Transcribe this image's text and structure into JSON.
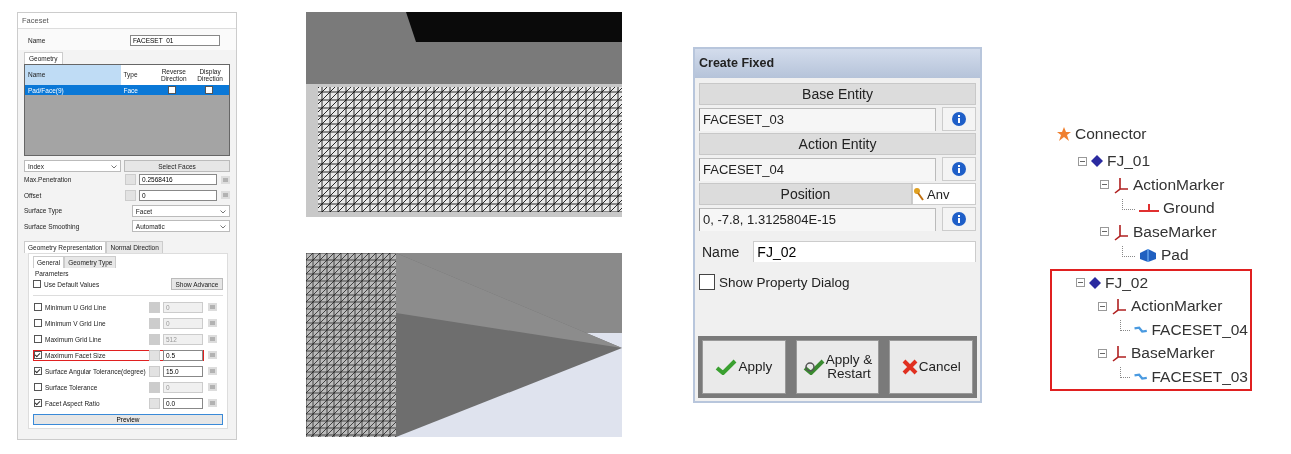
{
  "faceset_panel": {
    "title": "Faceset",
    "name_label": "Name",
    "name_value": "FACESET_01",
    "geometry_tab": "Geometry",
    "table": {
      "columns": [
        "Name",
        "Type",
        "Reverse Direction",
        "Display Direction"
      ],
      "rows": [
        {
          "name": "Pad/Face(9)",
          "type": "Face",
          "reverse_direction": false,
          "display_direction": false,
          "selected": true
        }
      ]
    },
    "index_dropdown": "Index",
    "select_faces_button": "Select Faces",
    "fields": [
      {
        "kind": "input",
        "label": "Max.Penetration",
        "value": "0.2568416"
      },
      {
        "kind": "input",
        "label": "Offset",
        "value": "0"
      },
      {
        "kind": "select",
        "label": "Surface Type",
        "value": "Facet"
      },
      {
        "kind": "select",
        "label": "Surface Smoothing",
        "value": "Automatic"
      }
    ],
    "tabs": [
      {
        "label": "Geometry Representation",
        "selected": true
      },
      {
        "label": "Normal Direction",
        "selected": false
      }
    ],
    "subtabs": [
      {
        "label": "General",
        "selected": true
      },
      {
        "label": "Geometry Type",
        "selected": false
      }
    ],
    "parameters_title": "Parameters",
    "use_default": {
      "label": "Use Default Values",
      "checked": false
    },
    "show_advance_button": "Show Advance",
    "params": [
      {
        "label": "Minimum U Grid Line",
        "checked": false,
        "value": "0",
        "highlighted": false
      },
      {
        "label": "Minimum V Grid Line",
        "checked": false,
        "value": "0",
        "highlighted": false
      },
      {
        "label": "Maximum Grid Line",
        "checked": false,
        "value": "512",
        "highlighted": false
      },
      {
        "label": "Maximum Facet Size",
        "checked": true,
        "value": "0.5",
        "highlighted": true
      },
      {
        "label": "Surface Angular Tolerance(degree)",
        "checked": true,
        "value": "15.0",
        "highlighted": false
      },
      {
        "label": "Surface Tolerance",
        "checked": false,
        "value": "0",
        "highlighted": false
      },
      {
        "label": "Facet Aspect Ratio",
        "checked": true,
        "value": "0.0",
        "highlighted": false
      }
    ],
    "preview_button": "Preview"
  },
  "create_fixed": {
    "title": "Create Fixed",
    "entities": [
      {
        "header": "Base Entity",
        "value": "FACESET_03"
      },
      {
        "header": "Action Entity",
        "value": "FACESET_04"
      },
      {
        "header": "Position",
        "value": "0, -7.8, 1.3125804E-15",
        "extra": "Anv"
      }
    ],
    "name_label": "Name",
    "name_value": "FJ_02",
    "show_property": {
      "label": "Show Property Dialog",
      "checked": false
    },
    "buttons": [
      {
        "kind": "apply",
        "label": "Apply"
      },
      {
        "kind": "restart",
        "label": "Apply &\nRestart"
      },
      {
        "kind": "cancel",
        "label": "Cancel"
      }
    ]
  },
  "tree": {
    "kind": "connector",
    "label": "Connector",
    "children": [
      {
        "kind": "joint",
        "label": "FJ_01",
        "highlighted": false,
        "children": [
          {
            "kind": "marker",
            "label": "ActionMarker",
            "children": [
              {
                "kind": "ground",
                "label": "Ground"
              }
            ]
          },
          {
            "kind": "marker",
            "label": "BaseMarker",
            "children": [
              {
                "kind": "body",
                "label": "Pad"
              }
            ]
          }
        ]
      },
      {
        "kind": "joint",
        "label": "FJ_02",
        "highlighted": true,
        "children": [
          {
            "kind": "marker",
            "label": "ActionMarker",
            "children": [
              {
                "kind": "faceset",
                "label": "FACESET_04"
              }
            ]
          },
          {
            "kind": "marker",
            "label": "BaseMarker",
            "children": [
              {
                "kind": "faceset",
                "label": "FACESET_03"
              }
            ]
          }
        ]
      }
    ]
  }
}
